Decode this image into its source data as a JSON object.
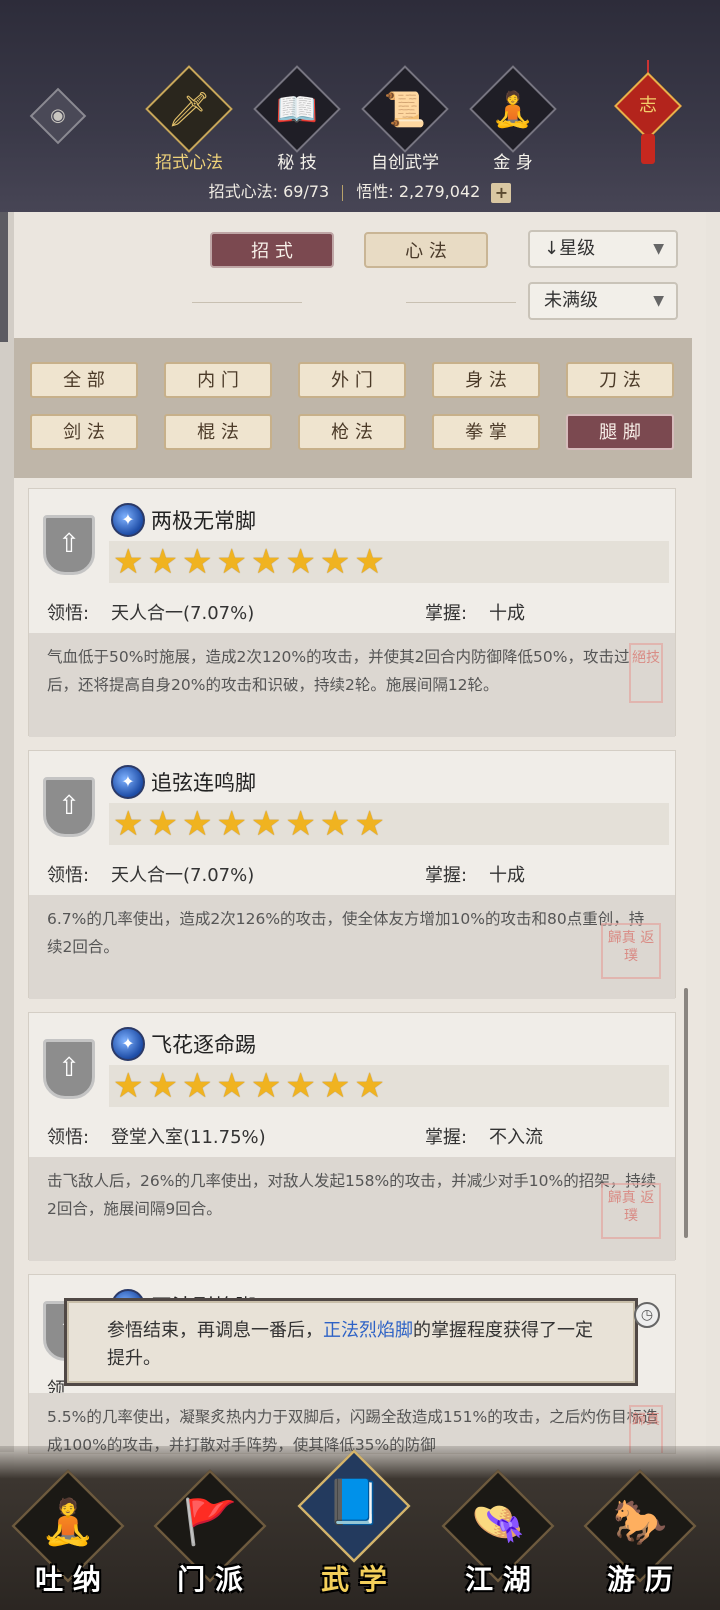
{
  "header": {
    "eye_icon": "eye-icon",
    "tabs": [
      {
        "label": "招式心法",
        "icon": "sword-icon",
        "active": true
      },
      {
        "label": "秘 技",
        "icon": "book-icon",
        "active": false
      },
      {
        "label": "自创武学",
        "icon": "scroll-icon",
        "active": false
      },
      {
        "label": "金 身",
        "icon": "meditation-icon",
        "active": false
      }
    ],
    "badge": "志",
    "stats": {
      "techniques_label": "招式心法:",
      "techniques_value": "69/73",
      "insight_label": "悟性:",
      "insight_value": "2,279,042",
      "plus": "+"
    }
  },
  "controls": {
    "tab_moves": "招 式",
    "tab_mind": "心 法",
    "sort": "↓星级",
    "filter_level": "未满级"
  },
  "filters": [
    "全 部",
    "内 门",
    "外 门",
    "身 法",
    "刀 法",
    "剑 法",
    "棍 法",
    "枪 法",
    "拳 掌",
    "腿 脚"
  ],
  "active_filter": "腿 脚",
  "cards": [
    {
      "name": "两极无常脚",
      "stars": "★★★★★★★★",
      "star_count": 8,
      "comprehension_label": "领悟:",
      "comprehension": "天人合一(7.07%)",
      "mastery_label": "掌握:",
      "mastery": "十成",
      "desc": "气血低于50%时施展，造成2次120%的攻击，并使其2回合内防御降低50%，攻击过后，还将提高自身20%的攻击和识破，持续2轮。施展间隔12轮。",
      "stamp": "絕技"
    },
    {
      "name": "追弦连鸣脚",
      "stars": "★★★★★★★★",
      "star_count": 8,
      "comprehension_label": "领悟:",
      "comprehension": "天人合一(7.07%)",
      "mastery_label": "掌握:",
      "mastery": "十成",
      "desc": "6.7%的几率使出，造成2次126%的攻击，使全体友方增加10%的攻击和80点重创，持续2回合。",
      "stamp": "歸真 返璞"
    },
    {
      "name": "飞花逐命踢",
      "stars": "★★★★★★★★",
      "star_count": 8,
      "comprehension_label": "领悟:",
      "comprehension": "登堂入室(11.75%)",
      "mastery_label": "掌握:",
      "mastery": "不入流",
      "desc": "击飞敌人后，26%的几率使出，对敌人发起158%的攻击，并减少对手10%的招架，持续2回合，施展间隔9回合。",
      "stamp": "歸真 返璞"
    },
    {
      "name": "正法烈焰脚",
      "comprehension_label": "领",
      "desc": "5.5%的几率使出，凝聚炙热内力于双脚后，闪踢全敌造成151%的攻击，之后灼伤目标造成100%的攻击，并打散对手阵势，使其降低35%的防御",
      "stamp": "歸真"
    }
  ],
  "toast": {
    "before": "参悟结束，再调息一番后，",
    "highlight": "正法烈焰脚",
    "after": "的掌握程度获得了一定提升。"
  },
  "bottom_nav": [
    {
      "label": "吐 纳",
      "icon": "monk-icon",
      "active": false
    },
    {
      "label": "门 派",
      "icon": "sect-flags-icon",
      "active": false
    },
    {
      "label": "武 学",
      "icon": "martial-books-icon",
      "active": true
    },
    {
      "label": "江 湖",
      "icon": "straw-hat-icon",
      "active": false
    },
    {
      "label": "游 历",
      "icon": "horse-icon",
      "active": false
    }
  ]
}
